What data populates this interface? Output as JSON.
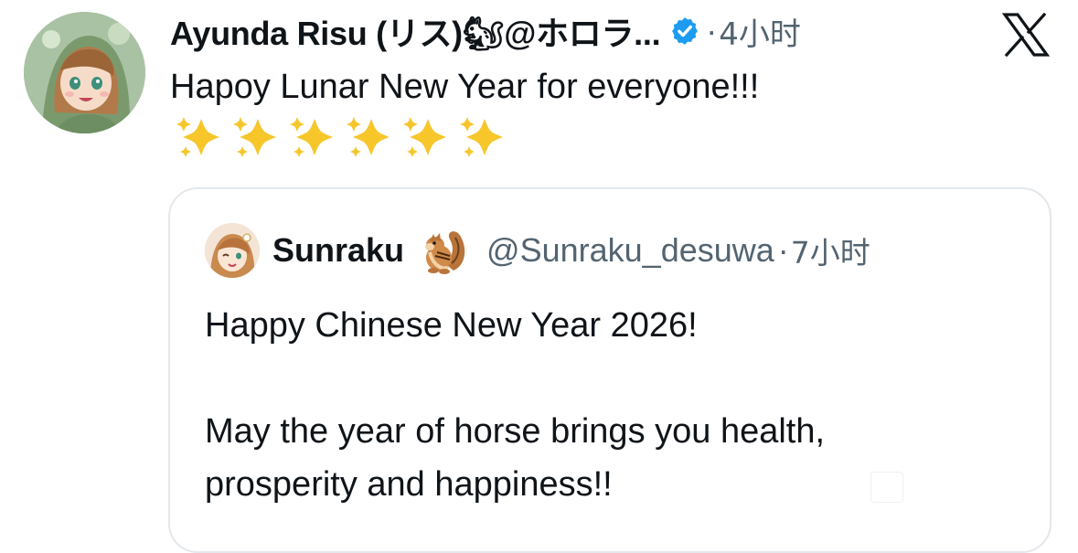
{
  "post": {
    "author_name": "Ayunda Risu (リス)🐿@ホロラ...",
    "separator": "·",
    "time": "4小时",
    "text": "Hapoy Lunar New Year for everyone!!!",
    "sparkle_count": 6,
    "icons": {
      "verified": "verified-badge-icon",
      "logo": "x-logo-icon",
      "sparkle": "sparkles-emoji"
    }
  },
  "quoted_post": {
    "author_name": "Sunraku",
    "handle": "@Sunraku_desuwa",
    "separator": "·",
    "time": "7小时",
    "lines": [
      "Happy Chinese New Year 2026!",
      "May the year of horse brings you health,",
      "prosperity and happiness!!"
    ],
    "icons": {
      "chipmunk": "chipmunk-emoji"
    }
  },
  "colors": {
    "text": "#0f1419",
    "secondary": "#536471",
    "verified": "#1d9bf0",
    "border": "#e4e8ec",
    "sparkle": "#f6c62b"
  }
}
